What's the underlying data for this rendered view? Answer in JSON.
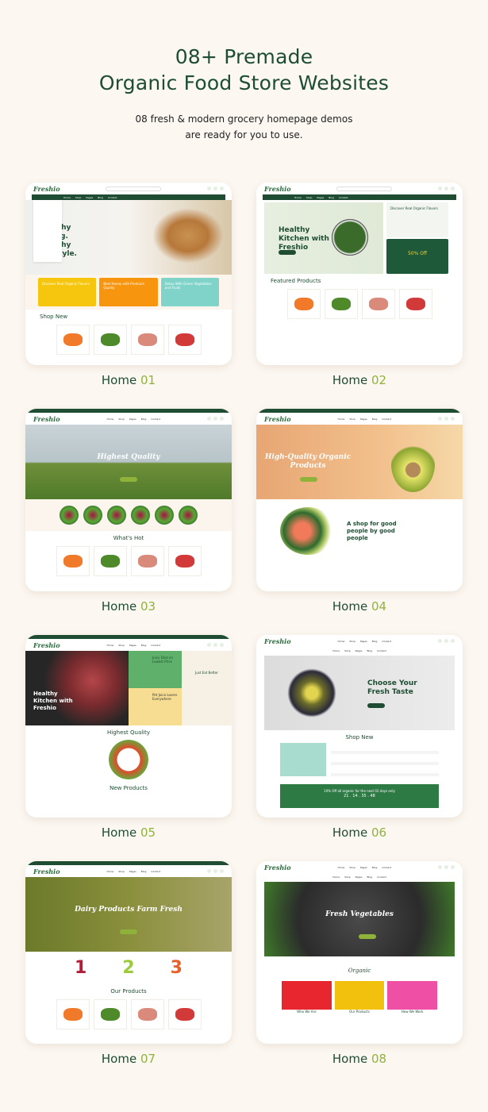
{
  "header": {
    "title_line1": "08+ Premade",
    "title_line2": "Organic Food Store Websites",
    "subtitle_line1": "08 fresh & modern grocery homepage demos",
    "subtitle_line2": "are ready for you to use."
  },
  "colors": {
    "brand_green": "#1e4d33",
    "accent_lime": "#8fb33a",
    "background": "#fcf7f1"
  },
  "demos": [
    {
      "label": "Home",
      "num": "01",
      "logo": "Freshio",
      "style": "a",
      "hero_title": "Healthy Eating. Healthy Lifestyle.",
      "hero_bg": "linear-gradient(90deg,#eef0ee,#f6f3ef 50%,#d8c7a8)",
      "banners": [
        {
          "text": "Discover Real Organic Flavors",
          "bg": "#f6c60f"
        },
        {
          "text": "Best Honey with Premium Quality",
          "bg": "#f7950e"
        },
        {
          "text": "Detox With Green Vegetables and Fruits",
          "bg": "#7fd3c9"
        }
      ],
      "section": "Shop New",
      "nav": [
        "Home",
        "Shop",
        "Pages",
        "Blog",
        "Contact"
      ]
    },
    {
      "label": "Home",
      "num": "02",
      "logo": "Freshio",
      "style": "b",
      "hero_title": "Healthy Kitchen with Freshio",
      "hero_bg": "linear-gradient(90deg,#e7efe0,#dfe9d6)",
      "side1": "Discover Real Organic Flavors",
      "side2": "50% Off",
      "section": "Featured Products",
      "nav": [
        "Home",
        "Shop",
        "Pages",
        "Blog",
        "Contact"
      ]
    },
    {
      "label": "Home",
      "num": "03",
      "logo": "Freshio",
      "style": "c",
      "hero_title": "Highest Quality",
      "hero_bg": "linear-gradient(180deg,#c9d3d8 0,#b7c4c8 50%,#6f8f3a 52%,#4f7a2a 100%)",
      "section": "What's Hot",
      "nav": [
        "Home",
        "Shop",
        "Pages",
        "Blog",
        "Contact"
      ]
    },
    {
      "label": "Home",
      "num": "04",
      "logo": "Freshio",
      "style": "d",
      "hero_title": "High-Quality Organic Products",
      "hero_bg": "linear-gradient(90deg,#e7a674,#f2c08c 60%,#f6d8a8)",
      "section": "A shop for good people by good people",
      "nav": [
        "Home",
        "Shop",
        "Pages",
        "Blog",
        "Contact"
      ]
    },
    {
      "label": "Home",
      "num": "05",
      "logo": "Freshio",
      "style": "e",
      "hero_title": "Healthy Kitchen with Freshio",
      "tiles": [
        {
          "text": "Juicy Deal on Lowest Price",
          "bg": "#5fb06a"
        },
        {
          "text": "Pet Juice Lovers Everywhere",
          "bg": "#f7dd92"
        },
        {
          "text": "Just Eat Better",
          "bg": "#f6f1e4"
        }
      ],
      "section": "Highest Quality",
      "section2": "New Products",
      "nav": [
        "Home",
        "Shop",
        "Pages",
        "Blog",
        "Contact"
      ]
    },
    {
      "label": "Home",
      "num": "06",
      "logo": "Freshio",
      "style": "f",
      "hero_title": "Choose Your Fresh Taste",
      "hero_bg": "linear-gradient(90deg,#dcdcdc,#ececec)",
      "section": "Shop New",
      "offer": "10% Off all organic for the next 02 days only",
      "countdown": "21 . 14 . 35 . 48",
      "nav": [
        "Home",
        "Shop",
        "Pages",
        "Blog",
        "Contact"
      ]
    },
    {
      "label": "Home",
      "num": "07",
      "logo": "Freshio",
      "style": "g",
      "hero_title": "Dairy Products Farm Fresh",
      "hero_bg": "linear-gradient(90deg,#6b7a2a,#8a8f3c 50%,#a8a46a)",
      "steps": [
        "1",
        "2",
        "3"
      ],
      "section": "Our Products",
      "nav": [
        "Home",
        "Shop",
        "Pages",
        "Blog",
        "Contact"
      ]
    },
    {
      "label": "Home",
      "num": "08",
      "logo": "Freshio",
      "style": "h",
      "hero_title": "Fresh Vegetables",
      "hero_bg": "radial-gradient(circle at 50% 50%,#4a4a4a,#2b2b2b 60%,#3f7a2a 100%)",
      "section": "Organic",
      "boxes": [
        {
          "text": "Who We Are",
          "bg": "#e8262f"
        },
        {
          "text": "Our Products",
          "bg": "#f2c10d"
        },
        {
          "text": "How We Work",
          "bg": "#ef4fa5"
        }
      ],
      "nav": [
        "Home",
        "Shop",
        "Pages",
        "Blog",
        "Contact"
      ]
    }
  ]
}
